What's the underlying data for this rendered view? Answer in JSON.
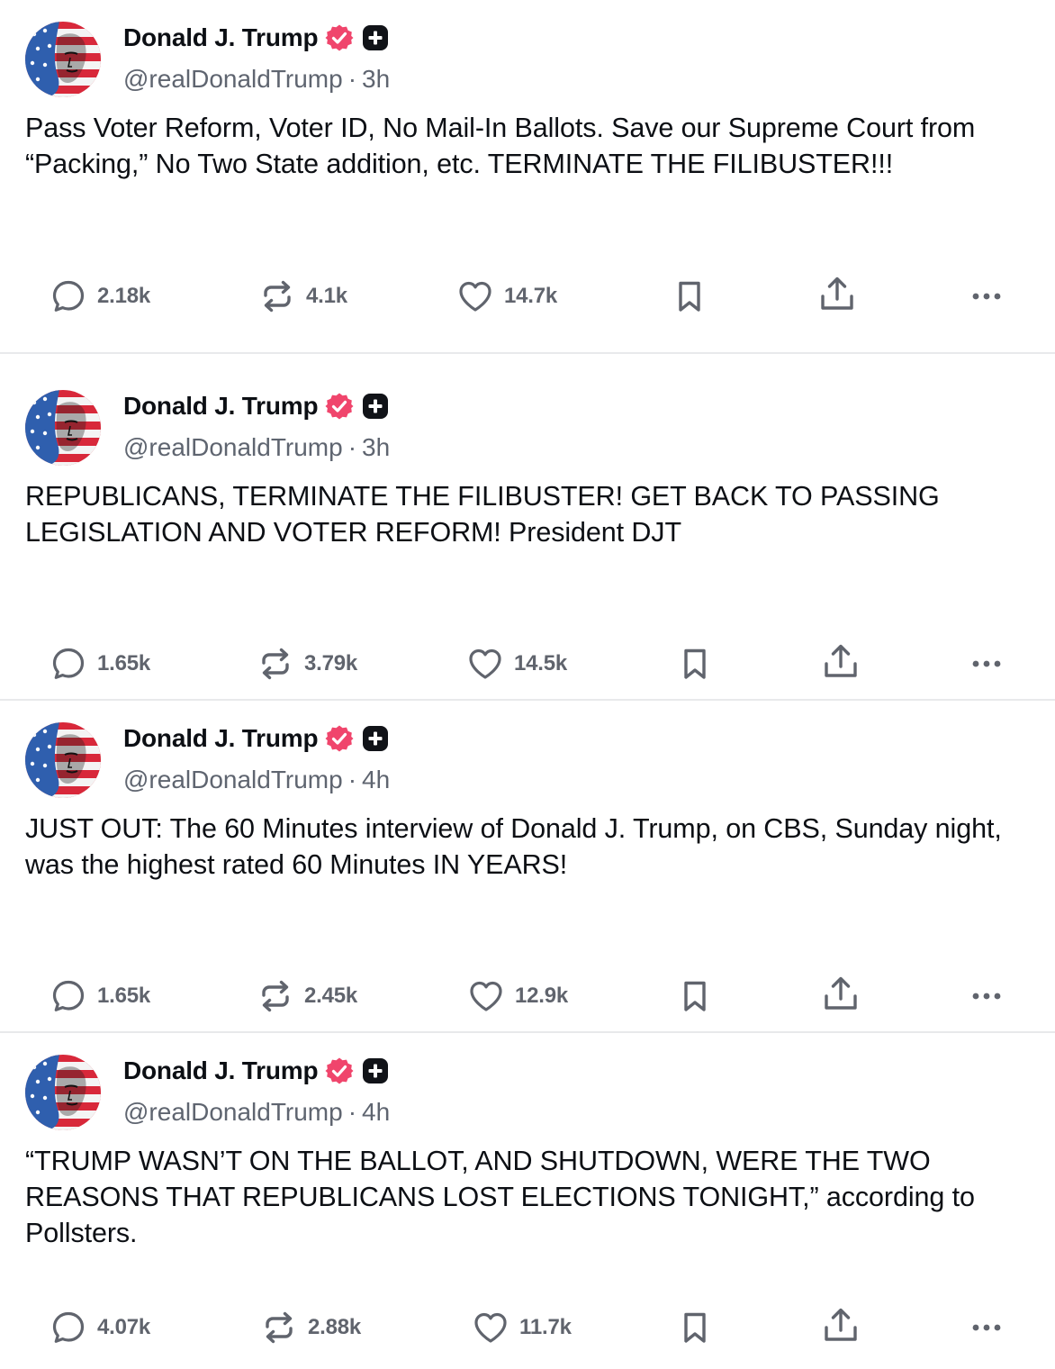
{
  "colors": {
    "verified_badge": "#f0456c",
    "plus_badge": "#111318",
    "divider": "#e8e9eb",
    "secondary_text": "#5f6570",
    "icon_gray": "#60646d"
  },
  "posts": [
    {
      "author_name": "Donald J. Trump",
      "handle": "@realDonaldTrump",
      "separator": "·",
      "time": "3h",
      "text": "Pass Voter Reform, Voter ID, No Mail-In Ballots. Save our Supreme Court from “Packing,” No Two State addition, etc. TERMINATE THE FILIBUSTER!!!",
      "replies": "2.18k",
      "reposts": "4.1k",
      "likes": "14.7k"
    },
    {
      "author_name": "Donald J. Trump",
      "handle": "@realDonaldTrump",
      "separator": "·",
      "time": "3h",
      "text": "REPUBLICANS, TERMINATE THE FILIBUSTER! GET BACK TO PASSING LEGISLATION AND VOTER REFORM! President DJT",
      "replies": "1.65k",
      "reposts": "3.79k",
      "likes": "14.5k"
    },
    {
      "author_name": "Donald J. Trump",
      "handle": "@realDonaldTrump",
      "separator": "·",
      "time": "4h",
      "text": "JUST OUT: The 60 Minutes interview of Donald J. Trump, on CBS, Sunday night, was the highest rated 60 Minutes IN YEARS!",
      "replies": "1.65k",
      "reposts": "2.45k",
      "likes": "12.9k"
    },
    {
      "author_name": "Donald J. Trump",
      "handle": "@realDonaldTrump",
      "separator": "·",
      "time": "4h",
      "text": "“TRUMP WASN’T ON THE BALLOT, AND SHUTDOWN, WERE THE TWO REASONS THAT REPUBLICANS LOST ELECTIONS TONIGHT,” according to Pollsters.",
      "replies": "4.07k",
      "reposts": "2.88k",
      "likes": "11.7k"
    }
  ],
  "icons": {
    "reply": "speech-bubble-icon",
    "repost": "repost-arrows-icon",
    "like": "heart-icon",
    "bookmark": "bookmark-icon",
    "share": "share-upload-icon",
    "more": "ellipsis-icon",
    "verified": "verified-badge-icon",
    "plus": "truth-plus-icon"
  }
}
